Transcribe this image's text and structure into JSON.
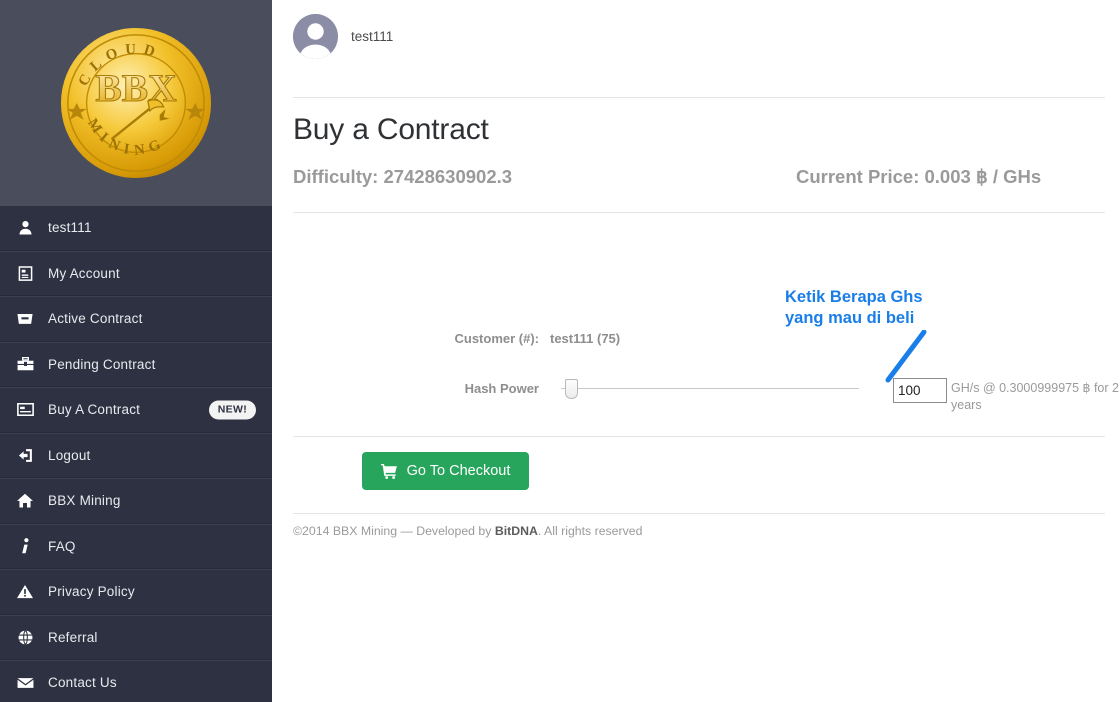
{
  "sidebar": {
    "logo": {
      "icon": "bbx-cloud-mining-coin-logo",
      "top_text": "CLOUD",
      "center_text": "BBX",
      "bottom_text": "MINING"
    },
    "items": [
      {
        "label": "test111",
        "icon": "user-icon",
        "badge": null
      },
      {
        "label": "My Account",
        "icon": "account-card-icon",
        "badge": null
      },
      {
        "label": "Active Contract",
        "icon": "briefcase-icon",
        "badge": null
      },
      {
        "label": "Pending Contract",
        "icon": "suitcase-icon",
        "badge": null
      },
      {
        "label": "Buy A Contract",
        "icon": "credit-card-icon",
        "badge": "NEW!"
      },
      {
        "label": "Logout",
        "icon": "logout-icon",
        "badge": null
      },
      {
        "label": "BBX Mining",
        "icon": "home-icon",
        "badge": null
      },
      {
        "label": "FAQ",
        "icon": "info-icon",
        "badge": null
      },
      {
        "label": "Privacy Policy",
        "icon": "warning-triangle-icon",
        "badge": null
      },
      {
        "label": "Referral",
        "icon": "globe-icon",
        "badge": null
      },
      {
        "label": "Contact Us",
        "icon": "envelope-icon",
        "badge": null
      }
    ]
  },
  "topbar": {
    "username": "test111",
    "avatar_icon": "user-avatar"
  },
  "page": {
    "title": "Buy a Contract",
    "difficulty": "Difficulty: 27428630902.3",
    "current_price": "Current Price: 0.003 ฿ / GHs"
  },
  "form": {
    "customer_label": "Customer (#):",
    "customer_value": "test111 (75)",
    "hash_power_label": "Hash Power",
    "hash_input_value": "100",
    "hash_input_placeholder": "",
    "hash_suffix": "GH/s @ 0.3000999975 ฿ for 2 years",
    "slider_position_percent": 1
  },
  "checkout": {
    "label": "Go To Checkout",
    "icon": "shopping-cart-icon",
    "color": "#27a55c"
  },
  "annotation": {
    "text": "Ketik Berapa Ghs\nyang mau di beli",
    "color": "#1a7ee8",
    "arrow_icon": "annotation-arrow"
  },
  "footer": {
    "prefix": "©2014 BBX Mining — Developed by ",
    "link": "BitDNA",
    "suffix": ". All rights reserved"
  },
  "colors": {
    "sidebar_bg": "#2d3142",
    "logo_panel_bg": "#4a4e5c",
    "accent_green": "#27a55c",
    "annotation_blue": "#1a7ee8",
    "muted_text": "#9a9a9a"
  }
}
